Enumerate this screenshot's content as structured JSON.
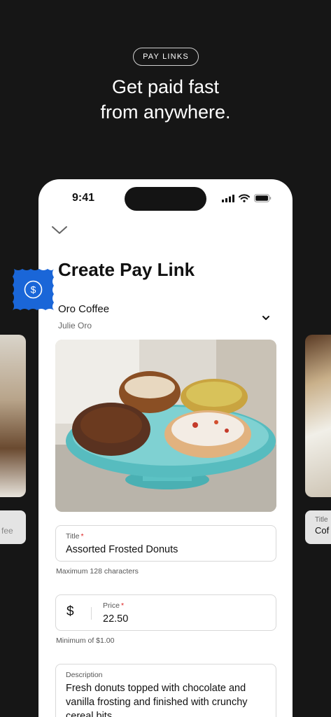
{
  "promo": {
    "pill": "PAY LINKS",
    "headline_line1": "Get paid fast",
    "headline_line2": "from anywhere."
  },
  "status_bar": {
    "time": "9:41"
  },
  "screen": {
    "title": "Create Pay Link",
    "merchant_name": "Oro Coffee",
    "merchant_owner": "Julie Oro"
  },
  "form": {
    "title_label": "Title",
    "title_value": "Assorted Frosted Donuts",
    "title_hint": "Maximum 128 characters",
    "price_symbol": "$",
    "price_label": "Price",
    "price_value": "22.50",
    "price_hint": "Minimum of $1.00",
    "description_label": "Description",
    "description_value": "Fresh donuts topped with chocolate and vanilla frosting and finished with crunchy cereal bits."
  },
  "side_cards": {
    "left_field_partial": "fee",
    "right_label": "Title",
    "right_value_partial": "Cof"
  },
  "colors": {
    "background": "#161616",
    "badge": "#1a66d8",
    "required": "#d22222"
  },
  "icons": {
    "badge": "dollar-icon",
    "collapse": "chevron-down-icon"
  }
}
